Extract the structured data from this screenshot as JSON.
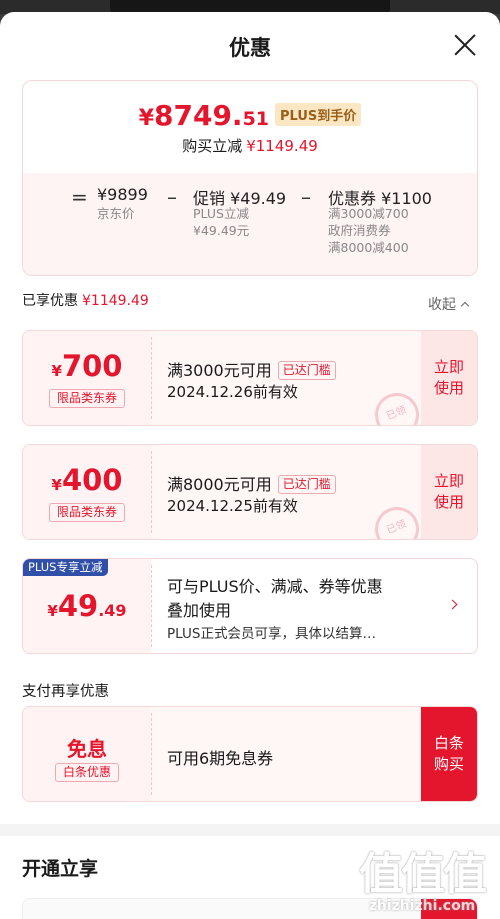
{
  "sheet": {
    "title": "优惠"
  },
  "summary": {
    "yen": "¥",
    "price_int": "8749.",
    "price_dec": "51",
    "plus_tag": "PLUS到手价",
    "reduce_label": "购买立减",
    "reduce_value": "¥1149.49",
    "eq_sign": "=",
    "minus_sign": "–",
    "jd_price": "¥9899",
    "jd_price_label": "京东价",
    "promo_label": "促销 ¥49.49",
    "promo_sub1": "PLUS立减",
    "promo_sub2": "¥49.49元",
    "coupon_label": "优惠券 ¥1100",
    "coupon_sub1": "满3000减700",
    "coupon_sub2": "政府消费券",
    "coupon_sub3": "满8000减400"
  },
  "enjoyed": {
    "label": "已享优惠",
    "value": "¥1149.49",
    "collapse": "收起"
  },
  "coupons": [
    {
      "yen": "¥",
      "amount": "700",
      "category": "限品类东券",
      "condition": "满3000元可用",
      "met": "已达门槛",
      "expiry": "2024.12.26前有效",
      "action_line1": "立即",
      "action_line2": "使用",
      "stamp": "已领"
    },
    {
      "yen": "¥",
      "amount": "400",
      "category": "限品类东券",
      "condition": "满8000元可用",
      "met": "已达门槛",
      "expiry": "2024.12.25前有效",
      "action_line1": "立即",
      "action_line2": "使用",
      "stamp": "已领"
    }
  ],
  "plus_offer": {
    "badge": "PLUS专享立减",
    "yen": "¥",
    "amount": "49",
    "decimal": ".49",
    "line1": "可与PLUS价、满减、券等优惠",
    "line2": "叠加使用",
    "line3": "PLUS正式会员可享，具体以结算…",
    "arrow_icon": "chevron-right-icon"
  },
  "payment": {
    "title": "支付再享优惠",
    "free_label": "免息",
    "free_tag": "白条优惠",
    "desc": "可用6期免息券",
    "btn_line1": "白条",
    "btn_line2": "购买"
  },
  "open": {
    "title": "开通立享"
  },
  "watermark": {
    "mark": "值值值",
    "url": "zhizhizhi.com"
  },
  "colors": {
    "accent_red": "#e3162d",
    "plus_blue": "#2f4fa8",
    "plus_gold": "#9b5e16"
  }
}
